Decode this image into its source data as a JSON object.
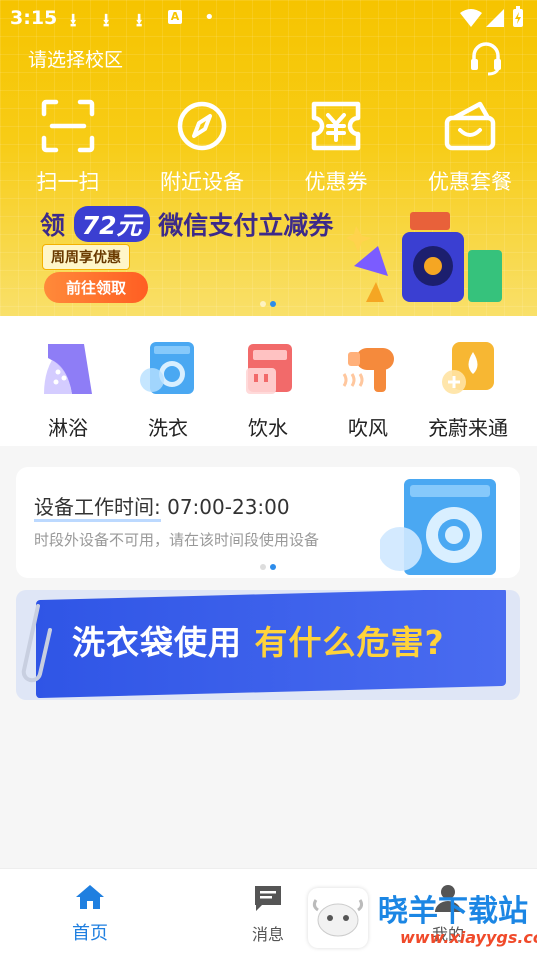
{
  "status_bar": {
    "time": "3:15",
    "download_icons": [
      "download-icon",
      "download-icon",
      "download-icon"
    ],
    "a_badge": "A",
    "dot": "•"
  },
  "header": {
    "campus_select": "请选择校区"
  },
  "quick_actions": [
    {
      "label": "扫一扫",
      "icon": "scan-icon"
    },
    {
      "label": "附近设备",
      "icon": "compass-icon"
    },
    {
      "label": "优惠券",
      "icon": "coupon-icon"
    },
    {
      "label": "优惠套餐",
      "icon": "package-icon"
    }
  ],
  "promo_banner": {
    "prefix": "领",
    "amount": "72元",
    "suffix": "微信支付立减券",
    "weekly": "周周享优惠",
    "button": "前往领取"
  },
  "categories": [
    {
      "label": "淋浴",
      "icon": "shower-icon"
    },
    {
      "label": "洗衣",
      "icon": "washer-icon"
    },
    {
      "label": "饮水",
      "icon": "water-dispenser-icon"
    },
    {
      "label": "吹风",
      "icon": "hair-dryer-icon"
    },
    {
      "label": "充蔚来通",
      "icon": "recharge-icon"
    }
  ],
  "notice": {
    "title_label": "设备工作时间:",
    "title_value": "07:00-23:00",
    "subtitle": "时段外设备不可用，请在该时间段使用设备"
  },
  "article_banner": {
    "text_white": "洗衣袋使用",
    "text_yellow": "有什么危害?"
  },
  "tabbar": [
    {
      "label": "首页",
      "icon": "home-icon",
      "active": true
    },
    {
      "label": "消息",
      "icon": "message-icon",
      "active": false
    },
    {
      "label": "我的",
      "icon": "profile-icon",
      "active": false
    }
  ],
  "watermark": {
    "name": "晓羊下载站",
    "url": "www.xiayygs.com"
  },
  "colors": {
    "accent": "#2d8ceb",
    "hero": "#f6c400",
    "tab_active": "#1f7fe0",
    "tab_inactive": "#555555"
  }
}
